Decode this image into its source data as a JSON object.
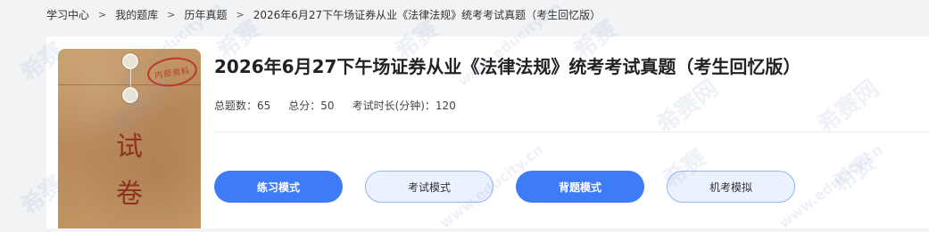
{
  "breadcrumb": {
    "items": [
      "学习中心",
      "我的题库",
      "历年真题",
      "2026年6月27下午场证券从业《法律法规》统考考试真题（考生回忆版）"
    ],
    "separator": ">"
  },
  "cover": {
    "stamp": "内部资料",
    "char1": "试",
    "char2": "卷"
  },
  "exam": {
    "title": "2026年6月27下午场证券从业《法律法规》统考考试真题（考生回忆版）",
    "total_questions": "总题数：65",
    "total_score": "总分：50",
    "duration": "考试时长(分钟)：120"
  },
  "buttons": {
    "practice": "练习模式",
    "exam": "考试模式",
    "recite": "背题模式",
    "machine": "机考模拟"
  },
  "watermark": {
    "text1": "希赛",
    "text2": "www.educity.cn",
    "text3": "希赛网"
  },
  "colors": {
    "primary": "#3d7bf7",
    "outline_bg": "#ebf1fe",
    "outline_border": "#93b4f5"
  }
}
